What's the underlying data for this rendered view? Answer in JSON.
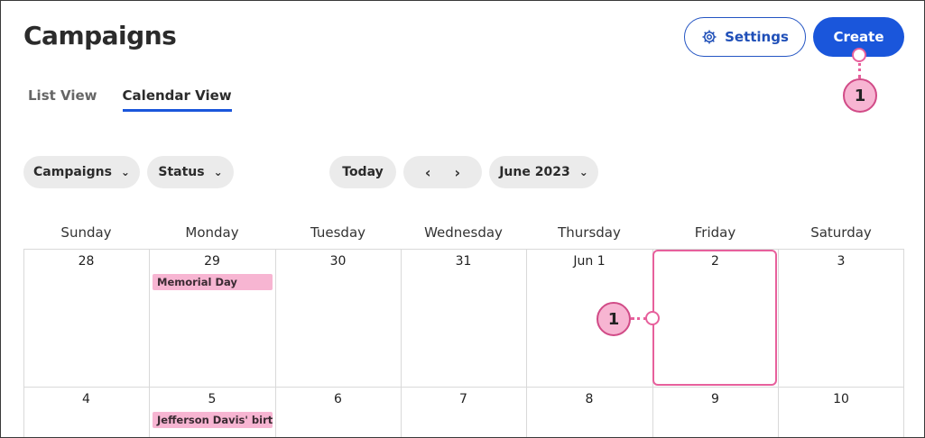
{
  "header": {
    "title": "Campaigns",
    "settings_label": "Settings",
    "create_label": "Create"
  },
  "tabs": [
    {
      "label": "List View",
      "active": false
    },
    {
      "label": "Calendar View",
      "active": true
    }
  ],
  "filters": {
    "campaigns_label": "Campaigns",
    "status_label": "Status",
    "today_label": "Today",
    "month_label": "June 2023"
  },
  "calendar": {
    "weekdays": [
      "Sunday",
      "Monday",
      "Tuesday",
      "Wednesday",
      "Thursday",
      "Friday",
      "Saturday"
    ],
    "week1": [
      "28",
      "29",
      "30",
      "31",
      "Jun 1",
      "2",
      "3"
    ],
    "week2": [
      "4",
      "5",
      "6",
      "7",
      "8",
      "9",
      "10"
    ],
    "events": {
      "memorial_day": "Memorial Day",
      "jefferson_davis": "Jefferson Davis' birthday"
    }
  },
  "callouts": {
    "create_marker": "1",
    "friday_marker": "1"
  },
  "colors": {
    "accent": "#1a56db",
    "event_pink": "#f7b5d2",
    "callout_pink": "#e7609c"
  },
  "icons": {
    "settings": "gear-icon",
    "dropdown": "chevron-down-icon",
    "prev": "chevron-left-icon",
    "next": "chevron-right-icon"
  }
}
